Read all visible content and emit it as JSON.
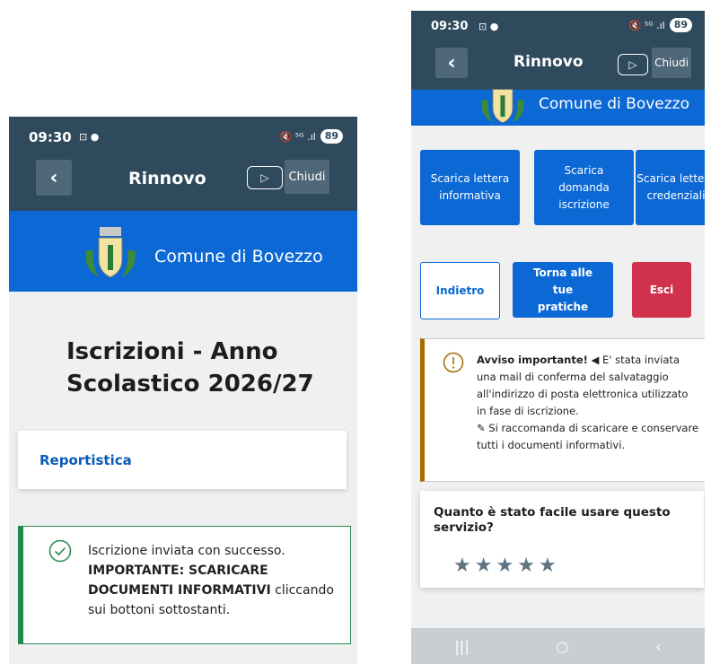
{
  "status": {
    "time": "09:30",
    "left_icons": "⊡ ●",
    "right_icons": "🔇 ⁵ᴳ .ıl",
    "battery": "89"
  },
  "appbar": {
    "title": "Rinnovo",
    "close_label": "Chiudi"
  },
  "banner": {
    "name": "Comune di Bovezzo"
  },
  "left": {
    "page_title": "Iscrizioni - Anno Scolastico 2026/27",
    "report_link": "Reportistica",
    "success": {
      "part1": "Iscrizione inviata con successo. ",
      "bold": "IMPORTANTE: SCARICARE DOCUMENTI INFORMATIVI",
      "part2": " cliccando sui bottoni sottostanti."
    }
  },
  "right": {
    "download_buttons": [
      {
        "label": "Scarica lettera informativa"
      },
      {
        "label": "Scarica domanda iscrizione"
      },
      {
        "label": "Scarica lettera credenziali"
      }
    ],
    "nav": {
      "back": "Indietro",
      "return": "Torna alle tue pratiche",
      "exit": "Esci"
    },
    "warning": {
      "bold": "Avviso importante!",
      "send_icon": "◀",
      "text1": " E' stata inviata una mail di conferma del salvataggio all'indirizzo di posta elettronica utilizzato in fase di iscrizione.",
      "edit_icon": "✎",
      "text2": " Si raccomanda di scaricare e conservare tutti i documenti informativi."
    },
    "feedback": {
      "question": "Quanto è stato facile usare questo servizio?",
      "rating_max": 5
    },
    "sysnav": {
      "recent": "|||",
      "home": "○",
      "back": "‹"
    }
  },
  "colors": {
    "appbar": "#2f4a5c",
    "banner": "#0b68d4",
    "success": "#1f8a4c",
    "danger": "#d0324d",
    "warning": "#a66a00"
  }
}
